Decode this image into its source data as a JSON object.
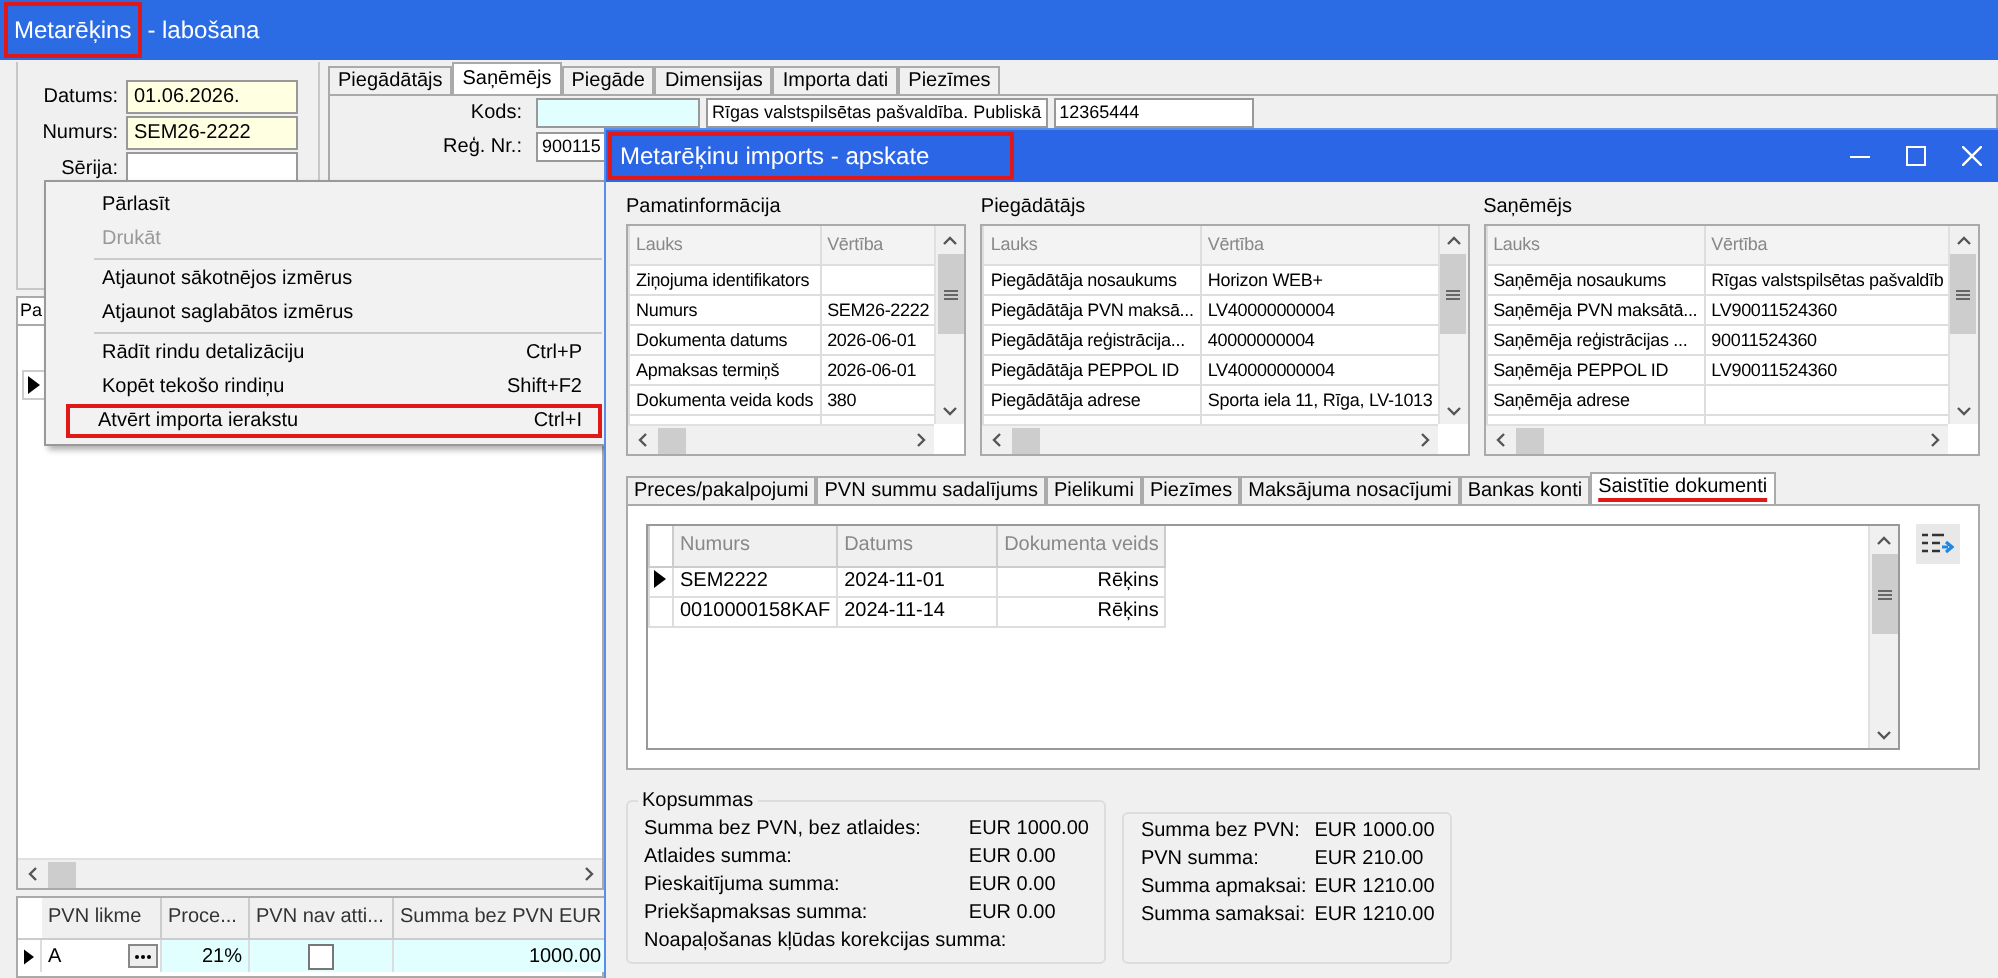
{
  "main_window": {
    "title": "Metarēķins",
    "title_suffix": "- labošana",
    "title_highlighted": true,
    "fields": [
      {
        "label": "Datums:",
        "value": "01.06.2026.",
        "required": true
      },
      {
        "label": "Numurs:",
        "value": "SEM26-2222",
        "required": true
      },
      {
        "label": "Sērija:",
        "required": false
      }
    ],
    "tabs": [
      {
        "label": "Piegādātājs",
        "selected": false
      },
      {
        "label": "Saņēmējs",
        "selected": true
      },
      {
        "label": "Piegāde",
        "selected": false
      },
      {
        "label": "Dimensijas",
        "selected": false
      },
      {
        "label": "Importa dati",
        "selected": false
      },
      {
        "label": "Piezīmes",
        "selected": false
      }
    ],
    "recipient_fields": [
      {
        "label": "Kods:",
        "required": true,
        "related": [
          "Rīgas valstspilsētas pašvaldība. Publiskā",
          "12365444"
        ]
      },
      {
        "label": "Reģ. Nr.:",
        "value": "900115",
        "required": false
      }
    ],
    "lower_tab": {
      "label": "Pa",
      "selected": true
    },
    "lower_grid": {
      "rows": [
        {
          "current": true
        }
      ]
    },
    "vat_grid": {
      "columns": [
        "PVN likme",
        "Proce...",
        "PVN nav atti...",
        "Summa bez PVN EUR"
      ],
      "rows": [
        {
          "rate": "A",
          "percent": "21%",
          "not_applicable": false,
          "amount": "1000.00",
          "current": true
        }
      ]
    }
  },
  "context_menu": {
    "items": [
      {
        "kind": "item",
        "label": "Pārlasīt",
        "disabled": false,
        "highlighted": false
      },
      {
        "kind": "item",
        "label": "Drukāt",
        "disabled": true,
        "highlighted": false
      },
      {
        "kind": "separator"
      },
      {
        "kind": "item",
        "label": "Atjaunot sākotnējos izmērus",
        "disabled": false,
        "highlighted": false
      },
      {
        "kind": "item",
        "label": "Atjaunot saglabātos izmērus",
        "disabled": false,
        "highlighted": false
      },
      {
        "kind": "separator"
      },
      {
        "kind": "item",
        "label": "Rādīt rindu detalizāciju",
        "shortcut": "Ctrl+P",
        "disabled": false,
        "highlighted": false
      },
      {
        "kind": "item",
        "label": "Kopēt tekošo rindiņu",
        "shortcut": "Shift+F2",
        "disabled": false,
        "highlighted": false
      },
      {
        "kind": "item",
        "label": "Atvērt importa ierakstu",
        "shortcut": "Ctrl+I",
        "disabled": false,
        "highlighted": true
      }
    ]
  },
  "import_dialog": {
    "title": "Metarēķinu imports - apskate",
    "title_highlighted": true,
    "sections": [
      {
        "title": "Pamatinformācija",
        "columns": [
          "Lauks",
          "Vērtība"
        ],
        "rows": [
          {
            "field": "Ziņojuma identifikators"
          },
          {
            "field": "Numurs",
            "value": "SEM26-2222"
          },
          {
            "field": "Dokumenta datums",
            "value": "2026-06-01"
          },
          {
            "field": "Apmaksas termiņš",
            "value": "2026-06-01"
          },
          {
            "field": "Dokumenta veida kods",
            "value": "380"
          }
        ]
      },
      {
        "title": "Piegādātājs",
        "columns": [
          "Lauks",
          "Vērtība"
        ],
        "rows": [
          {
            "field": "Piegādātāja nosaukums",
            "value": "Horizon WEB+"
          },
          {
            "field": "Piegādātāja PVN maksā...",
            "value": "LV40000000004"
          },
          {
            "field": "Piegādātāja reģistrācija...",
            "value": "40000000004"
          },
          {
            "field": "Piegādātāja PEPPOL ID",
            "value": "LV40000000004"
          },
          {
            "field": "Piegādātāja adrese",
            "value": "Sporta iela 11, Rīga, LV-1013"
          }
        ]
      },
      {
        "title": "Saņēmējs",
        "columns": [
          "Lauks",
          "Vērtība"
        ],
        "rows": [
          {
            "field": "Saņēmēja nosaukums",
            "value": "Rīgas valstspilsētas pašvaldīb"
          },
          {
            "field": "Saņēmēja PVN maksātā...",
            "value": "LV90011524360"
          },
          {
            "field": "Saņēmēja reģistrācijas ...",
            "value": "90011524360"
          },
          {
            "field": "Saņēmēja PEPPOL ID",
            "value": "LV90011524360"
          },
          {
            "field": "Saņēmēja adrese"
          }
        ]
      }
    ],
    "tabs": [
      {
        "label": "Preces/pakalpojumi",
        "selected": false,
        "underlined": false
      },
      {
        "label": "PVN summu sadalījums",
        "selected": false,
        "underlined": false
      },
      {
        "label": "Pielikumi",
        "selected": false,
        "underlined": false
      },
      {
        "label": "Piezīmes",
        "selected": false,
        "underlined": false
      },
      {
        "label": "Maksājuma nosacījumi",
        "selected": false,
        "underlined": false
      },
      {
        "label": "Bankas konti",
        "selected": false,
        "underlined": false
      },
      {
        "label": "Saistītie dokumenti",
        "selected": true,
        "underlined": true
      }
    ],
    "linked_documents": {
      "columns": [
        "Numurs",
        "Datums",
        "Dokumenta veids"
      ],
      "rows": [
        {
          "number": "SEM2222",
          "date": "2024-11-01",
          "type": "Rēķins",
          "current": true
        },
        {
          "number": "0010000158KAF",
          "date": "2024-11-14",
          "type": "Rēķins",
          "current": false
        }
      ]
    },
    "totals": {
      "title": "Kopsummas",
      "left": [
        {
          "label": "Summa bez PVN, bez atlaides:",
          "value": "EUR 1000.00"
        },
        {
          "label": "Atlaides summa:",
          "value": "EUR 0.00"
        },
        {
          "label": "Pieskaitījuma summa:",
          "value": "EUR 0.00"
        },
        {
          "label": "Priekšapmaksas summa:",
          "value": "EUR 0.00"
        },
        {
          "label": "Noapaļošanas kļūdas korekcijas summa:"
        }
      ],
      "right": [
        {
          "label": "Summa bez PVN:",
          "value": "EUR 1000.00"
        },
        {
          "label": "PVN summa:",
          "value": "EUR 210.00"
        },
        {
          "label": "Summa apmaksai:",
          "value": "EUR 1210.00"
        },
        {
          "label": "Summa samaksai:",
          "value": "EUR 1210.00"
        }
      ]
    }
  }
}
